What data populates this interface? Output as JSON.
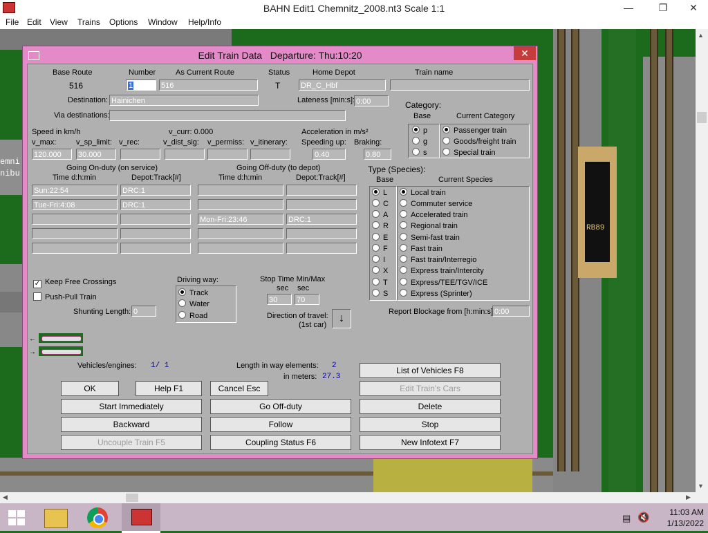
{
  "window": {
    "title": "BAHN Edit1 Chemnitz_2008.nt3 Scale 1:1",
    "minimize_icon": "minimize-icon",
    "restore_icon": "restore-icon",
    "close_icon": "close-icon"
  },
  "menu": [
    "File",
    "Edit",
    "View",
    "Trains",
    "Options",
    "Window",
    "Help/Info"
  ],
  "map": {
    "label_1": "emni",
    "label_2": "nibu",
    "station_label": "RB89"
  },
  "dialog": {
    "title": "Edit Train Data",
    "departure": "Departure: Thu:10:20",
    "close_glyph": "✕",
    "headers": {
      "base_route": "Base Route",
      "number": "Number",
      "as_current_route": "As Current Route",
      "status": "Status",
      "home_depot": "Home Depot",
      "train_name": "Train name"
    },
    "base_route": "516",
    "number": "1",
    "current_route": "516",
    "status": "T",
    "home_depot": "DR_C_Hbf",
    "train_name": "",
    "destination_label": "Destination:",
    "destination": "Hainichen",
    "lateness_label": "Lateness [min:s]:",
    "lateness": "0:00",
    "via_label": "Via destinations:",
    "via": "",
    "speed": {
      "title": "Speed in km/h",
      "v_curr": "v_curr: 0.000",
      "v_max_label": "v_max:",
      "v_sp_limit_label": "v_sp_limit:",
      "v_rec_label": "v_rec:",
      "v_dist_sig_label": "v_dist_sig:",
      "v_permiss_label": "v_permiss:",
      "v_itinerary_label": "v_itinerary:",
      "v_max": "120.000",
      "v_sp_limit": "30.000",
      "v_rec": "",
      "v_dist_sig": "",
      "v_permiss": "",
      "v_itinerary": ""
    },
    "accel": {
      "title": "Acceleration in m/s²",
      "up_label": "Speeding up:",
      "brake_label": "Braking:",
      "up": "0.40",
      "brake": "0.80"
    },
    "category": {
      "title": "Category:",
      "base_header": "Base",
      "current_header": "Current Category",
      "base": [
        {
          "label": "p",
          "on": true
        },
        {
          "label": "g",
          "on": false
        },
        {
          "label": "s",
          "on": false
        }
      ],
      "current": [
        {
          "label": "Passenger train",
          "on": true
        },
        {
          "label": "Goods/freight train",
          "on": false
        },
        {
          "label": "Special train",
          "on": false
        }
      ]
    },
    "on_duty": {
      "title": "Going On-duty (on service)",
      "time_header": "Time  d:h:min",
      "depot_header": "Depot:Track[#]",
      "rows": [
        {
          "time": "Sun:22:54",
          "depot": "DRC:1"
        },
        {
          "time": "Tue-Fri:4:08",
          "depot": "DRC:1"
        },
        {
          "time": "",
          "depot": ""
        },
        {
          "time": "",
          "depot": ""
        },
        {
          "time": "",
          "depot": ""
        }
      ]
    },
    "off_duty": {
      "title": "Going Off-duty (to depot)",
      "time_header": "Time  d:h:min",
      "depot_header": "Depot:Track[#]",
      "rows": [
        {
          "time": "",
          "depot": ""
        },
        {
          "time": "",
          "depot": ""
        },
        {
          "time": "Mon-Fri:23:46",
          "depot": "DRC:1"
        },
        {
          "time": "",
          "depot": ""
        },
        {
          "time": "",
          "depot": ""
        }
      ]
    },
    "species": {
      "title": "Type (Species):",
      "base_header": "Base",
      "current_header": "Current Species",
      "base": [
        {
          "label": "L",
          "on": true
        },
        {
          "label": "C",
          "on": false
        },
        {
          "label": "A",
          "on": false
        },
        {
          "label": "R",
          "on": false
        },
        {
          "label": "E",
          "on": false
        },
        {
          "label": "F",
          "on": false
        },
        {
          "label": "I",
          "on": false
        },
        {
          "label": "X",
          "on": false
        },
        {
          "label": "T",
          "on": false
        },
        {
          "label": "S",
          "on": false
        }
      ],
      "current": [
        {
          "label": "Local train",
          "on": true
        },
        {
          "label": "Commuter service",
          "on": false
        },
        {
          "label": "Accelerated train",
          "on": false
        },
        {
          "label": "Regional train",
          "on": false
        },
        {
          "label": "Semi-fast train",
          "on": false
        },
        {
          "label": "Fast train",
          "on": false
        },
        {
          "label": "Fast train/Interregio",
          "on": false
        },
        {
          "label": "Express train/Intercity",
          "on": false
        },
        {
          "label": "Express/TEE/TGV/ICE",
          "on": false
        },
        {
          "label": "Express (Sprinter)",
          "on": false
        }
      ]
    },
    "keep_free_crossings": "Keep Free Crossings",
    "push_pull_train": "Push-Pull Train",
    "shunting_label": "Shunting Length:",
    "shunting": "0",
    "driving_way": {
      "title": "Driving way:",
      "options": [
        {
          "label": "Track",
          "on": true
        },
        {
          "label": "Water",
          "on": false
        },
        {
          "label": "Road",
          "on": false
        }
      ]
    },
    "stop_time": {
      "title": "Stop Time Min/Max",
      "sec1": "sec",
      "sec2": "sec",
      "min": "30",
      "max": "70"
    },
    "direction": {
      "label1": "Direction of travel:",
      "label2": "(1st car)",
      "arrow": "↓"
    },
    "report_label": "Report Blockage from [h:min:s]:",
    "report": "0:00",
    "vehicles_label": "Vehicles/engines:",
    "vehicles_value": "1/   1",
    "length_label": "Length in way elements:",
    "length_value": "2",
    "meters_label": "in meters:",
    "meters_value": "27.3",
    "buttons": {
      "list_vehicles": "List of Vehicles  F8",
      "edit_cars": "Edit Train's Cars",
      "ok": "OK",
      "help": "Help       F1",
      "cancel": "Cancel    Esc",
      "start": "Start Immediately",
      "go_off_duty": "Go Off-duty",
      "delete": "Delete",
      "backward": "Backward",
      "follow": "Follow",
      "stop": "Stop",
      "uncouple": "Uncouple Train    F5",
      "coupling": "Coupling Status   F6",
      "infotext": "New Infotext       F7"
    }
  },
  "taskbar": {
    "time": "11:03 AM",
    "date": "1/13/2022"
  }
}
